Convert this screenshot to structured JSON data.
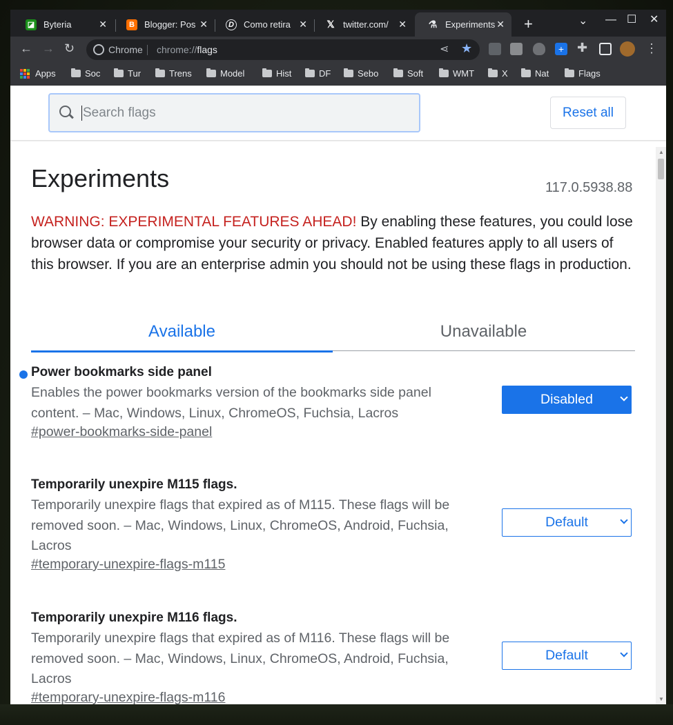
{
  "tabs": [
    {
      "title": "Byteria",
      "favicon": "byteria-icon",
      "color": "#1a8f1a",
      "active": false
    },
    {
      "title": "Blogger: Pos",
      "favicon": "blogger-icon",
      "color": "#ff6f00",
      "active": false
    },
    {
      "title": "Como retira",
      "favicon": "d-icon",
      "color": "#202124",
      "active": false
    },
    {
      "title": "twitter.com/",
      "favicon": "x-icon",
      "color": "#202124",
      "active": false
    },
    {
      "title": "Experiments",
      "favicon": "flask-icon",
      "color": "#e8eaed",
      "active": true
    }
  ],
  "omnibox": {
    "chip": "Chrome",
    "scheme": "chrome://",
    "path": "flags"
  },
  "bookmarks": [
    "Apps",
    "Soc",
    "Tur",
    "Trens",
    "Model",
    "Hist",
    "DF",
    "Sebo",
    "Soft",
    "WMT",
    "X",
    "Nat",
    "Flags"
  ],
  "header": {
    "search_placeholder": "Search flags",
    "reset_label": "Reset all"
  },
  "main": {
    "title": "Experiments",
    "version": "117.0.5938.88",
    "warning_lead": "WARNING: EXPERIMENTAL FEATURES AHEAD!",
    "warning_body": " By enabling these features, you could lose browser data or compromise your security or privacy. Enabled features apply to all users of this browser. If you are an enterprise admin you should not be using these flags in production.",
    "tab_available": "Available",
    "tab_unavailable": "Unavailable"
  },
  "flags": [
    {
      "name": "Power bookmarks side panel",
      "description": "Enables the power bookmarks version of the bookmarks side panel content. – Mac, Windows, Linux, ChromeOS, Fuchsia, Lacros",
      "link": "#power-bookmarks-side-panel",
      "value": "Disabled",
      "modified": true
    },
    {
      "name": "Temporarily unexpire M115 flags.",
      "description": "Temporarily unexpire flags that expired as of M115. These flags will be removed soon. – Mac, Windows, Linux, ChromeOS, Android, Fuchsia, Lacros",
      "link": "#temporary-unexpire-flags-m115",
      "value": "Default",
      "modified": false
    },
    {
      "name": "Temporarily unexpire M116 flags.",
      "description": "Temporarily unexpire flags that expired as of M116. These flags will be removed soon. – Mac, Windows, Linux, ChromeOS, Android, Fuchsia, Lacros",
      "link": "#temporary-unexpire-flags-m116",
      "value": "Default",
      "modified": false
    }
  ],
  "colors": {
    "accent": "#1a73e8",
    "warning": "#c5221f"
  }
}
